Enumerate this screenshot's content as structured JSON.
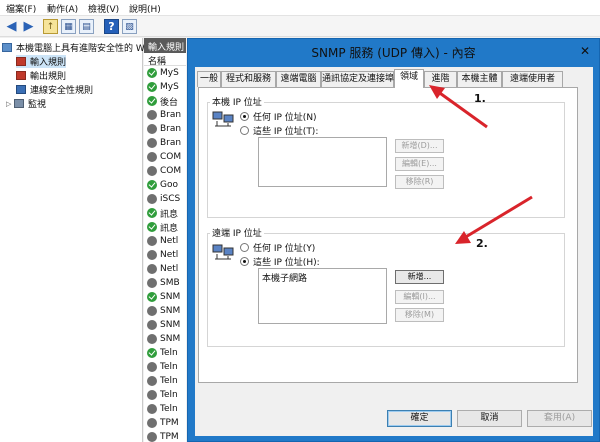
{
  "menubar": [
    "檔案(F)",
    "動作(A)",
    "檢視(V)",
    "說明(H)"
  ],
  "tree": {
    "root": "本機電腦上具有進階安全性的 W",
    "items": [
      "輸入規則",
      "輸出規則",
      "連線安全性規則",
      "監視"
    ]
  },
  "rules": {
    "title": "輸入規則",
    "column": "名稱",
    "rows": [
      {
        "name": "MyS",
        "enabled": true
      },
      {
        "name": "MyS",
        "enabled": true
      },
      {
        "name": "後台",
        "enabled": true
      },
      {
        "name": "Bran",
        "enabled": false
      },
      {
        "name": "Bran",
        "enabled": false
      },
      {
        "name": "Bran",
        "enabled": false
      },
      {
        "name": "COM",
        "enabled": false
      },
      {
        "name": "COM",
        "enabled": false
      },
      {
        "name": "Goo",
        "enabled": true
      },
      {
        "name": "iSCS",
        "enabled": false
      },
      {
        "name": "訊息",
        "enabled": true
      },
      {
        "name": "訊息",
        "enabled": true
      },
      {
        "name": "Netl",
        "enabled": false
      },
      {
        "name": "Netl",
        "enabled": false
      },
      {
        "name": "Netl",
        "enabled": false
      },
      {
        "name": "SMB",
        "enabled": false
      },
      {
        "name": "SNM",
        "enabled": true
      },
      {
        "name": "SNM",
        "enabled": false
      },
      {
        "name": "SNM",
        "enabled": false
      },
      {
        "name": "SNM",
        "enabled": false
      },
      {
        "name": "Teln",
        "enabled": true
      },
      {
        "name": "Teln",
        "enabled": false
      },
      {
        "name": "Teln",
        "enabled": false
      },
      {
        "name": "Teln",
        "enabled": false
      },
      {
        "name": "Teln",
        "enabled": false
      },
      {
        "name": "TPM",
        "enabled": false
      },
      {
        "name": "TPM",
        "enabled": false
      }
    ]
  },
  "dialog": {
    "title": "SNMP 服務 (UDP 傳入) - 內容",
    "tabs": [
      "一般",
      "程式和服務",
      "遠端電腦",
      "通訊協定及連接埠",
      "領域",
      "進階",
      "本機主體",
      "遠端使用者"
    ],
    "active_tab": 4,
    "local": {
      "label": "本機 IP 位址",
      "any": "任何 IP 位址(N)",
      "these": "這些 IP 位址(T):",
      "selected": "any",
      "items": [],
      "add": "新增(D)...",
      "edit": "編輯(E)...",
      "remove": "移除(R)"
    },
    "remote": {
      "label": "遠端 IP 位址",
      "any": "任何 IP 位址(Y)",
      "these": "這些 IP 位址(H):",
      "selected": "these",
      "items": [
        "本機子網路"
      ],
      "add": "新增...",
      "edit": "編輯(I)...",
      "remove": "移除(M)"
    },
    "buttons": {
      "ok": "確定",
      "cancel": "取消",
      "apply": "套用(A)"
    }
  },
  "annotations": [
    "1.",
    "2."
  ],
  "colors": {
    "dialog_frame": "#2179c8",
    "arrow": "#d9242b",
    "enabled_rule": "#2f9d3b"
  }
}
